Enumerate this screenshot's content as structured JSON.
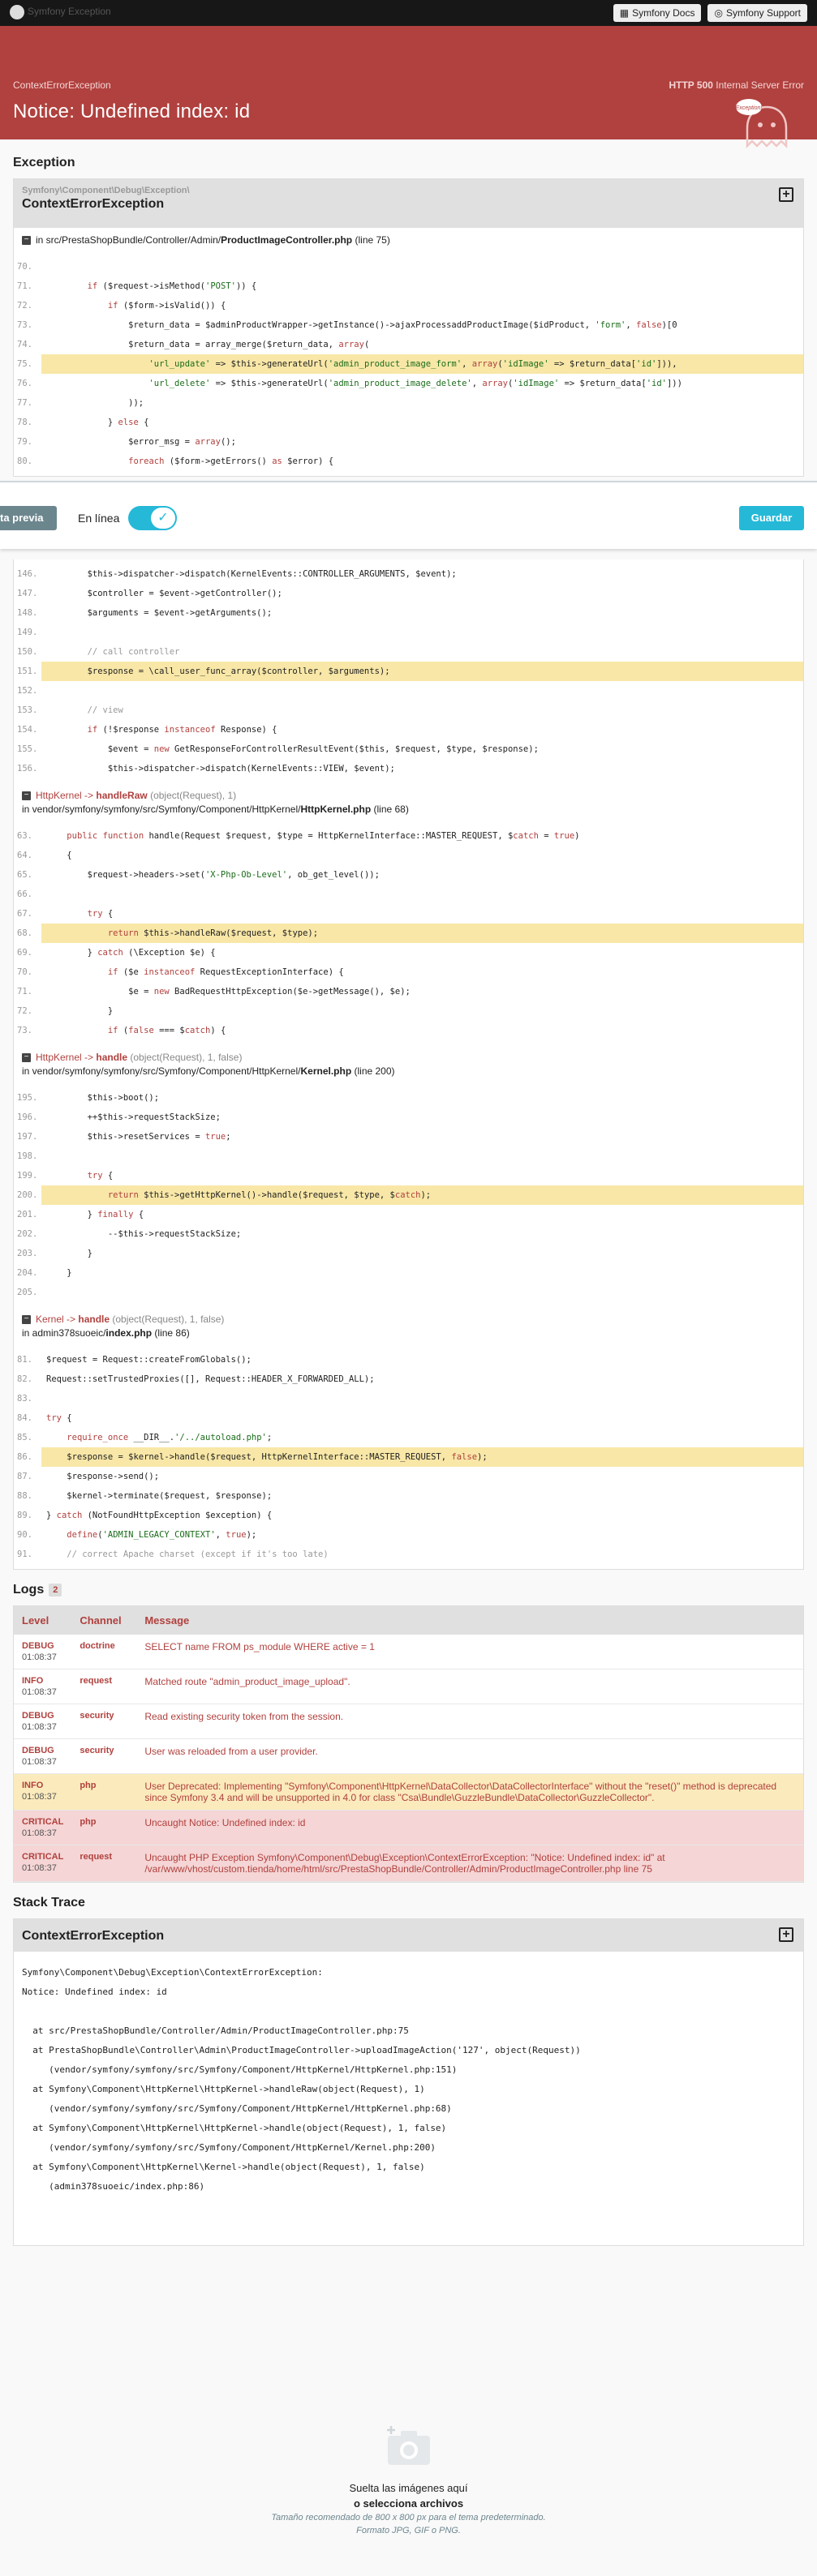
{
  "topbar": {
    "brand": "Symfony Exception",
    "docs": "Symfony Docs",
    "support": "Symfony Support"
  },
  "banner": {
    "exception_class": "ContextErrorException",
    "http_label": "HTTP 500",
    "http_text": "Internal Server Error",
    "title": "Notice: Undefined index: id",
    "ghost_text": "Exception!"
  },
  "exception": {
    "heading": "Exception",
    "namespace": "Symfony\\Component\\Debug\\Exception\\",
    "name": "ContextErrorException",
    "location_prefix": "in src/PrestaShopBundle/Controller/Admin/",
    "location_file": "ProductImageController.php",
    "location_line": "(line 75)"
  },
  "code1": [
    {
      "no": "70.",
      "text": ""
    },
    {
      "no": "71.",
      "text": "        if ($request->isMethod('POST')) {"
    },
    {
      "no": "72.",
      "text": "            if ($form->isValid()) {"
    },
    {
      "no": "73.",
      "text": "                $return_data = $adminProductWrapper->getInstance()->ajaxProcessaddProductImage($idProduct, 'form', false)[0"
    },
    {
      "no": "74.",
      "text": "                $return_data = array_merge($return_data, array("
    },
    {
      "no": "75.",
      "text": "                    'url_update' => $this->generateUrl('admin_product_image_form', array('idImage' => $return_data['id'])),",
      "hl": true
    },
    {
      "no": "76.",
      "text": "                    'url_delete' => $this->generateUrl('admin_product_image_delete', array('idImage' => $return_data['id']))"
    },
    {
      "no": "77.",
      "text": "                ));"
    },
    {
      "no": "78.",
      "text": "            } else {"
    },
    {
      "no": "79.",
      "text": "                $error_msg = array();"
    },
    {
      "no": "80.",
      "text": "                foreach ($form->getErrors() as $error) {"
    }
  ],
  "floatbar": {
    "preview": "ta previa",
    "online": "En línea",
    "save": "Guardar"
  },
  "code2": [
    {
      "no": "146.",
      "text": "        $this->dispatcher->dispatch(KernelEvents::CONTROLLER_ARGUMENTS, $event);"
    },
    {
      "no": "147.",
      "text": "        $controller = $event->getController();"
    },
    {
      "no": "148.",
      "text": "        $arguments = $event->getArguments();"
    },
    {
      "no": "149.",
      "text": ""
    },
    {
      "no": "150.",
      "text": "        // call controller"
    },
    {
      "no": "151.",
      "text": "        $response = \\call_user_func_array($controller, $arguments);",
      "hl": true
    },
    {
      "no": "152.",
      "text": ""
    },
    {
      "no": "153.",
      "text": "        // view"
    },
    {
      "no": "154.",
      "text": "        if (!$response instanceof Response) {"
    },
    {
      "no": "155.",
      "text": "            $event = new GetResponseForControllerResultEvent($this, $request, $type, $response);"
    },
    {
      "no": "156.",
      "text": "            $this->dispatcher->dispatch(KernelEvents::VIEW, $event);"
    }
  ],
  "trace1": {
    "cls": "HttpKernel",
    "arrow": " -> ",
    "fn": "handleRaw",
    "args": " (object(Request), 1)",
    "path": "in vendor/symfony/symfony/src/Symfony/Component/HttpKernel/",
    "file": "HttpKernel.php",
    "line": " (line 68)"
  },
  "code3": [
    {
      "no": "63.",
      "text": "    public function handle(Request $request, $type = HttpKernelInterface::MASTER_REQUEST, $catch = true)"
    },
    {
      "no": "64.",
      "text": "    {"
    },
    {
      "no": "65.",
      "text": "        $request->headers->set('X-Php-Ob-Level', ob_get_level());"
    },
    {
      "no": "66.",
      "text": ""
    },
    {
      "no": "67.",
      "text": "        try {"
    },
    {
      "no": "68.",
      "text": "            return $this->handleRaw($request, $type);",
      "hl": true
    },
    {
      "no": "69.",
      "text": "        } catch (\\Exception $e) {"
    },
    {
      "no": "70.",
      "text": "            if ($e instanceof RequestExceptionInterface) {"
    },
    {
      "no": "71.",
      "text": "                $e = new BadRequestHttpException($e->getMessage(), $e);"
    },
    {
      "no": "72.",
      "text": "            }"
    },
    {
      "no": "73.",
      "text": "            if (false === $catch) {"
    }
  ],
  "trace2": {
    "cls": "HttpKernel",
    "arrow": " -> ",
    "fn": "handle",
    "args": " (object(Request), 1, false)",
    "path": "in vendor/symfony/symfony/src/Symfony/Component/HttpKernel/",
    "file": "Kernel.php",
    "line": " (line 200)"
  },
  "code4": [
    {
      "no": "195.",
      "text": "        $this->boot();"
    },
    {
      "no": "196.",
      "text": "        ++$this->requestStackSize;"
    },
    {
      "no": "197.",
      "text": "        $this->resetServices = true;"
    },
    {
      "no": "198.",
      "text": ""
    },
    {
      "no": "199.",
      "text": "        try {"
    },
    {
      "no": "200.",
      "text": "            return $this->getHttpKernel()->handle($request, $type, $catch);",
      "hl": true
    },
    {
      "no": "201.",
      "text": "        } finally {"
    },
    {
      "no": "202.",
      "text": "            --$this->requestStackSize;"
    },
    {
      "no": "203.",
      "text": "        }"
    },
    {
      "no": "204.",
      "text": "    }"
    },
    {
      "no": "205.",
      "text": ""
    }
  ],
  "trace3": {
    "cls": "Kernel",
    "arrow": " -> ",
    "fn": "handle",
    "args": " (object(Request), 1, false)",
    "path": "in admin378suoeic/",
    "file": "index.php",
    "line": " (line 86)"
  },
  "code5": [
    {
      "no": "81.",
      "text": "$request = Request::createFromGlobals();"
    },
    {
      "no": "82.",
      "text": "Request::setTrustedProxies([], Request::HEADER_X_FORWARDED_ALL);"
    },
    {
      "no": "83.",
      "text": ""
    },
    {
      "no": "84.",
      "text": "try {"
    },
    {
      "no": "85.",
      "text": "    require_once __DIR__.'/../autoload.php';"
    },
    {
      "no": "86.",
      "text": "    $response = $kernel->handle($request, HttpKernelInterface::MASTER_REQUEST, false);",
      "hl": true
    },
    {
      "no": "87.",
      "text": "    $response->send();"
    },
    {
      "no": "88.",
      "text": "    $kernel->terminate($request, $response);"
    },
    {
      "no": "89.",
      "text": "} catch (NotFoundHttpException $exception) {"
    },
    {
      "no": "90.",
      "text": "    define('ADMIN_LEGACY_CONTEXT', true);"
    },
    {
      "no": "91.",
      "text": "    // correct Apache charset (except if it's too late)"
    }
  ],
  "logs": {
    "heading": "Logs",
    "count": "2",
    "headers": [
      "Level",
      "Channel",
      "Message"
    ],
    "rows": [
      {
        "level": "DEBUG",
        "time": "01:08:37",
        "channel": "doctrine",
        "message": "SELECT name FROM ps_module WHERE active = 1",
        "kind": ""
      },
      {
        "level": "INFO",
        "time": "01:08:37",
        "channel": "request",
        "message": "Matched route \"admin_product_image_upload\".",
        "kind": ""
      },
      {
        "level": "DEBUG",
        "time": "01:08:37",
        "channel": "security",
        "message": "Read existing security token from the session.",
        "kind": ""
      },
      {
        "level": "DEBUG",
        "time": "01:08:37",
        "channel": "security",
        "message": "User was reloaded from a user provider.",
        "kind": ""
      },
      {
        "level": "INFO",
        "time": "01:08:37",
        "channel": "php",
        "message": "User Deprecated: Implementing \"Symfony\\Component\\HttpKernel\\DataCollector\\DataCollectorInterface\" without the \"reset()\" method is deprecated since Symfony 3.4 and will be unsupported in 4.0 for class \"Csa\\Bundle\\GuzzleBundle\\DataCollector\\GuzzleCollector\".",
        "kind": "warn"
      },
      {
        "level": "CRITICAL",
        "time": "01:08:37",
        "channel": "php",
        "message": "Uncaught Notice: Undefined index: id",
        "kind": "crit"
      },
      {
        "level": "CRITICAL",
        "time": "01:08:37",
        "channel": "request",
        "message": "Uncaught PHP Exception Symfony\\Component\\Debug\\Exception\\ContextErrorException: \"Notice: Undefined index: id\" at /var/www/vhost/custom.tienda/home/html/src/PrestaShopBundle/Controller/Admin/ProductImageController.php line 75",
        "kind": "crit"
      }
    ]
  },
  "stack": {
    "heading": "Stack Trace",
    "title": "ContextErrorException",
    "text": "Symfony\\Component\\Debug\\Exception\\ContextErrorException:\nNotice: Undefined index: id\n\n  at src/PrestaShopBundle/Controller/Admin/ProductImageController.php:75\n  at PrestaShopBundle\\Controller\\Admin\\ProductImageController->uploadImageAction('127', object(Request))\n     (vendor/symfony/symfony/src/Symfony/Component/HttpKernel/HttpKernel.php:151)\n  at Symfony\\Component\\HttpKernel\\HttpKernel->handleRaw(object(Request), 1)\n     (vendor/symfony/symfony/src/Symfony/Component/HttpKernel/HttpKernel.php:68)\n  at Symfony\\Component\\HttpKernel\\HttpKernel->handle(object(Request), 1, false)\n     (vendor/symfony/symfony/src/Symfony/Component/HttpKernel/Kernel.php:200)\n  at Symfony\\Component\\HttpKernel\\Kernel->handle(object(Request), 1, false)\n     (admin378suoeic/index.php:86)"
  },
  "dropzone": {
    "line1": "Suelta las imágenes aquí",
    "line2": "o selecciona archivos",
    "line3": "Tamaño recomendado de 800 x 800 px para el tema predeterminado.",
    "line4": "Formato JPG, GIF o PNG."
  }
}
